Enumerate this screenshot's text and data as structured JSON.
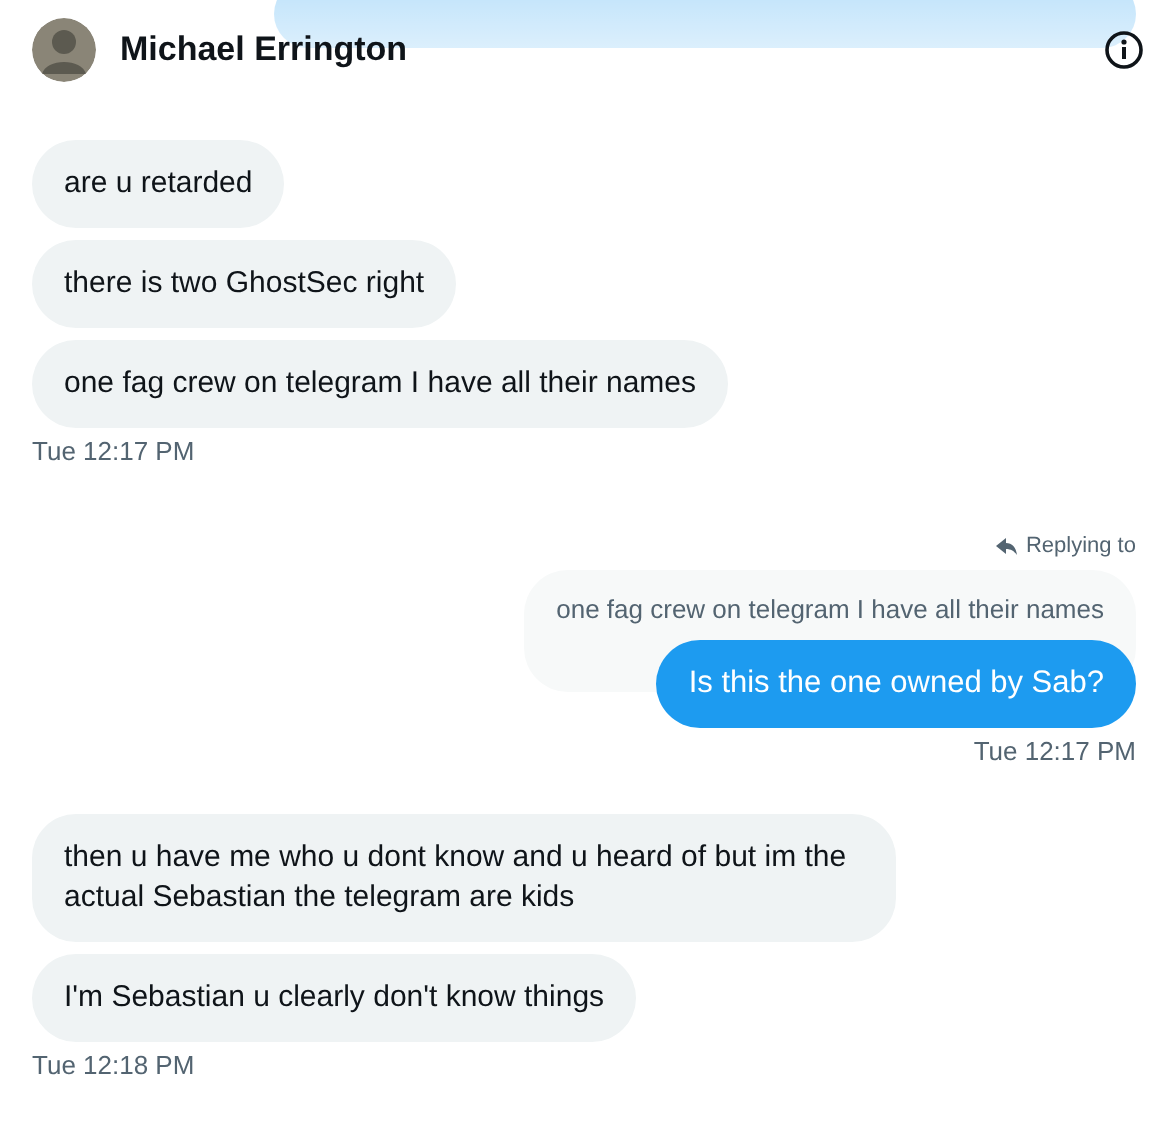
{
  "header": {
    "name": "Michael Errington"
  },
  "groups": [
    {
      "kind": "received",
      "messages": [
        "are u retarded",
        "there is two GhostSec right",
        "one fag crew on telegram I have all their names"
      ],
      "time": "Tue 12:17 PM"
    },
    {
      "kind": "sent",
      "reply": {
        "label": "Replying to",
        "quote": "one fag crew on telegram I have all their names"
      },
      "messages": [
        "Is this the one owned by Sab?"
      ],
      "time": "Tue 12:17 PM"
    },
    {
      "kind": "received",
      "messages": [
        "then u have me who u dont know and u heard of but im the actual Sebastian the telegram are kids",
        "I'm Sebastian u clearly don't know things"
      ],
      "time": "Tue 12:18 PM"
    }
  ]
}
